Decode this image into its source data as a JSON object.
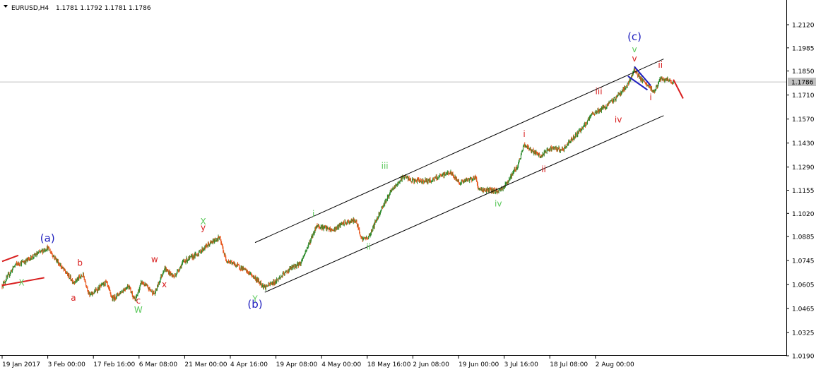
{
  "header": {
    "symbol": "EURUSD,H4",
    "ohlc": "1.1781 1.1792 1.1781 1.1786"
  },
  "colors": {
    "background": "#ffffff",
    "bull_candle": "#2e8b2e",
    "bear_candle": "#e8541a",
    "channel": "#000000",
    "wave_blue": "#1e1ebe",
    "wave_green": "#5ac85a",
    "wave_red": "#d81e1e",
    "bid_line": "#c0c0c0",
    "price_tag_bg": "#c0c0c0"
  },
  "chart_data": {
    "type": "candlestick",
    "title": "",
    "current_price": "1.1786",
    "y_ticks": [
      "1.2120",
      "1.1985",
      "1.1850",
      "1.1710",
      "1.1570",
      "1.1430",
      "1.1290",
      "1.1155",
      "1.1020",
      "1.0885",
      "1.0745",
      "1.0605",
      "1.0465",
      "1.0325",
      "1.0190"
    ],
    "x_ticks": [
      "19 Jan 2017",
      "3 Feb 00:00",
      "17 Feb 16:00",
      "6 Mar 08:00",
      "21 Mar 00:00",
      "4 Apr 16:00",
      "19 Apr 08:00",
      "4 May 00:00",
      "18 May 16:00",
      "2 Jun 08:00",
      "19 Jun 00:00",
      "3 Jul 16:00",
      "18 Jul 08:00",
      "2 Aug 00:00"
    ],
    "anchors": [
      {
        "date": "2017-01-19",
        "price": 1.06
      },
      {
        "date": "2017-01-23",
        "price": 1.072
      },
      {
        "date": "2017-01-26",
        "price": 1.074
      },
      {
        "date": "2017-02-02",
        "price": 1.082
      },
      {
        "date": "2017-02-07",
        "price": 1.069
      },
      {
        "date": "2017-02-10",
        "price": 1.062
      },
      {
        "date": "2017-02-13",
        "price": 1.066
      },
      {
        "date": "2017-02-15",
        "price": 1.054
      },
      {
        "date": "2017-02-20",
        "price": 1.062
      },
      {
        "date": "2017-02-22",
        "price": 1.052
      },
      {
        "date": "2017-02-27",
        "price": 1.06
      },
      {
        "date": "2017-03-01",
        "price": 1.051
      },
      {
        "date": "2017-03-03",
        "price": 1.062
      },
      {
        "date": "2017-03-07",
        "price": 1.055
      },
      {
        "date": "2017-03-10",
        "price": 1.07
      },
      {
        "date": "2017-03-13",
        "price": 1.065
      },
      {
        "date": "2017-03-16",
        "price": 1.074
      },
      {
        "date": "2017-03-20",
        "price": 1.078
      },
      {
        "date": "2017-03-23",
        "price": 1.083
      },
      {
        "date": "2017-03-27",
        "price": 1.088
      },
      {
        "date": "2017-03-29",
        "price": 1.075
      },
      {
        "date": "2017-04-03",
        "price": 1.07
      },
      {
        "date": "2017-04-06",
        "price": 1.066
      },
      {
        "date": "2017-04-10",
        "price": 1.059
      },
      {
        "date": "2017-04-13",
        "price": 1.062
      },
      {
        "date": "2017-04-18",
        "price": 1.07
      },
      {
        "date": "2017-04-21",
        "price": 1.073
      },
      {
        "date": "2017-04-24",
        "price": 1.086
      },
      {
        "date": "2017-04-26",
        "price": 1.095
      },
      {
        "date": "2017-05-01",
        "price": 1.092
      },
      {
        "date": "2017-05-04",
        "price": 1.096
      },
      {
        "date": "2017-05-08",
        "price": 1.098
      },
      {
        "date": "2017-05-10",
        "price": 1.087
      },
      {
        "date": "2017-05-12",
        "price": 1.088
      },
      {
        "date": "2017-05-16",
        "price": 1.105
      },
      {
        "date": "2017-05-19",
        "price": 1.115
      },
      {
        "date": "2017-05-23",
        "price": 1.124
      },
      {
        "date": "2017-05-25",
        "price": 1.121
      },
      {
        "date": "2017-05-31",
        "price": 1.121
      },
      {
        "date": "2017-06-06",
        "price": 1.126
      },
      {
        "date": "2017-06-09",
        "price": 1.12
      },
      {
        "date": "2017-06-14",
        "price": 1.123
      },
      {
        "date": "2017-06-15",
        "price": 1.116
      },
      {
        "date": "2017-06-21",
        "price": 1.115
      },
      {
        "date": "2017-06-23",
        "price": 1.118
      },
      {
        "date": "2017-06-27",
        "price": 1.13
      },
      {
        "date": "2017-06-29",
        "price": 1.142
      },
      {
        "date": "2017-07-04",
        "price": 1.135
      },
      {
        "date": "2017-07-07",
        "price": 1.14
      },
      {
        "date": "2017-07-11",
        "price": 1.139
      },
      {
        "date": "2017-07-13",
        "price": 1.144
      },
      {
        "date": "2017-07-18",
        "price": 1.154
      },
      {
        "date": "2017-07-20",
        "price": 1.16
      },
      {
        "date": "2017-07-24",
        "price": 1.164
      },
      {
        "date": "2017-07-27",
        "price": 1.169
      },
      {
        "date": "2017-07-31",
        "price": 1.177
      },
      {
        "date": "2017-08-02",
        "price": 1.186
      },
      {
        "date": "2017-08-04",
        "price": 1.18
      },
      {
        "date": "2017-08-08",
        "price": 1.173
      },
      {
        "date": "2017-08-10",
        "price": 1.18
      },
      {
        "date": "2017-08-11",
        "price": 1.18
      },
      {
        "date": "2017-08-14",
        "price": 1.1786
      }
    ]
  },
  "annotations": {
    "channel_lines": [
      {
        "from": {
          "date": "2017-04-07",
          "price": 1.085
        },
        "to": {
          "date": "2017-08-11",
          "price": 1.192
        }
      },
      {
        "from": {
          "date": "2017-04-10",
          "price": 1.056
        },
        "to": {
          "date": "2017-08-11",
          "price": 1.159
        }
      }
    ],
    "small_channel_lines": [
      {
        "from": {
          "date": "2017-01-19",
          "price": 1.074
        },
        "to": {
          "date": "2017-01-24",
          "price": 1.0775
        }
      },
      {
        "from": {
          "date": "2017-01-19",
          "price": 1.06
        },
        "to": {
          "date": "2017-02-01",
          "price": 1.0645
        }
      }
    ],
    "pattern_lines_blue": [
      {
        "from": {
          "date": "2017-07-31",
          "price": 1.182
        },
        "to": {
          "date": "2017-08-06",
          "price": 1.174
        }
      },
      {
        "from": {
          "date": "2017-08-02",
          "price": 1.1875
        },
        "to": {
          "date": "2017-08-07",
          "price": 1.1765
        }
      }
    ],
    "projection_line_red": {
      "from": {
        "date": "2017-08-14",
        "price": 1.18
      },
      "to": {
        "date": "2017-08-17",
        "price": 1.169
      }
    },
    "wave_labels": [
      {
        "text": "(a)",
        "date": "2017-02-02",
        "price": 1.0855,
        "color": "wave_blue",
        "big": true
      },
      {
        "text": "X",
        "date": "2017-01-25",
        "price": 1.06,
        "color": "wave_green"
      },
      {
        "text": "b",
        "date": "2017-02-12",
        "price": 1.0715,
        "color": "wave_red"
      },
      {
        "text": "a",
        "date": "2017-02-10",
        "price": 1.051,
        "color": "wave_red"
      },
      {
        "text": "c",
        "date": "2017-03-02",
        "price": 1.0495,
        "color": "wave_red"
      },
      {
        "text": "W",
        "date": "2017-03-02",
        "price": 1.044,
        "color": "wave_green"
      },
      {
        "text": "w",
        "date": "2017-03-07",
        "price": 1.0735,
        "color": "wave_red"
      },
      {
        "text": "x",
        "date": "2017-03-10",
        "price": 1.059,
        "color": "wave_red"
      },
      {
        "text": "X",
        "date": "2017-03-22",
        "price": 1.0955,
        "color": "wave_green"
      },
      {
        "text": "y",
        "date": "2017-03-22",
        "price": 1.092,
        "color": "wave_red"
      },
      {
        "text": "Y",
        "date": "2017-04-07",
        "price": 1.0505,
        "color": "wave_green"
      },
      {
        "text": "(b)",
        "date": "2017-04-07",
        "price": 1.047,
        "color": "wave_blue",
        "big": true
      },
      {
        "text": "i",
        "date": "2017-04-25",
        "price": 1.1,
        "color": "wave_green"
      },
      {
        "text": "ii",
        "date": "2017-05-12",
        "price": 1.081,
        "color": "wave_green"
      },
      {
        "text": "iii",
        "date": "2017-05-17",
        "price": 1.128,
        "color": "wave_green"
      },
      {
        "text": "iv",
        "date": "2017-06-21",
        "price": 1.106,
        "color": "wave_green"
      },
      {
        "text": "i",
        "date": "2017-06-29",
        "price": 1.1465,
        "color": "wave_red"
      },
      {
        "text": "ii",
        "date": "2017-07-05",
        "price": 1.126,
        "color": "wave_red"
      },
      {
        "text": "iii",
        "date": "2017-07-22",
        "price": 1.1715,
        "color": "wave_red"
      },
      {
        "text": "iv",
        "date": "2017-07-28",
        "price": 1.155,
        "color": "wave_red"
      },
      {
        "text": "(c)",
        "date": "2017-08-02",
        "price": 1.203,
        "color": "wave_blue",
        "big": true
      },
      {
        "text": "v",
        "date": "2017-08-02",
        "price": 1.196,
        "color": "wave_green"
      },
      {
        "text": "v",
        "date": "2017-08-02",
        "price": 1.1905,
        "color": "wave_red"
      },
      {
        "text": "i",
        "date": "2017-08-07",
        "price": 1.168,
        "color": "wave_red"
      },
      {
        "text": "ii",
        "date": "2017-08-10",
        "price": 1.187,
        "color": "wave_red"
      }
    ]
  }
}
